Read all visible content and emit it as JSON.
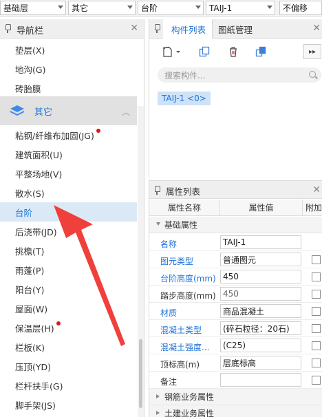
{
  "toolbar": {
    "combo1": "基础层",
    "combo2": "其它",
    "combo3": "台阶",
    "combo4": "TAIJ-1",
    "combo5": "不偏移"
  },
  "nav": {
    "title": "导航栏",
    "items_top": [
      "垫层(X)",
      "地沟(G)",
      "砖胎膜"
    ],
    "category": "其它",
    "items": [
      {
        "label": "粘钢/纤维布加固(JG)",
        "dot": true
      },
      {
        "label": "建筑面积(U)",
        "dot": false
      },
      {
        "label": "平整场地(V)",
        "dot": false
      },
      {
        "label": "散水(S)",
        "dot": false
      },
      {
        "label": "台阶",
        "dot": false,
        "active": true
      },
      {
        "label": "后浇带(JD)",
        "dot": false
      },
      {
        "label": "挑檐(T)",
        "dot": false
      },
      {
        "label": "雨蓬(P)",
        "dot": false
      },
      {
        "label": "阳台(Y)",
        "dot": false
      },
      {
        "label": "屋面(W)",
        "dot": false
      },
      {
        "label": "保温层(H)",
        "dot": true
      },
      {
        "label": "栏板(K)",
        "dot": false
      },
      {
        "label": "压顶(YD)",
        "dot": false
      },
      {
        "label": "栏杆扶手(G)",
        "dot": false
      },
      {
        "label": "脚手架(JS)",
        "dot": false
      }
    ]
  },
  "components": {
    "tab_active": "构件列表",
    "tab_other": "图纸管理",
    "search_placeholder": "搜索构件...",
    "selected": "TAIJ-1 <0>"
  },
  "properties": {
    "title": "属性列表",
    "col_name": "属性名称",
    "col_value": "属性值",
    "col_extra": "附加",
    "group_basic": "基础属性",
    "rows": [
      {
        "name": "名称",
        "value": "TAIJ-1",
        "link": true,
        "check": false
      },
      {
        "name": "图元类型",
        "value": "普通图元",
        "link": true,
        "check": true
      },
      {
        "name": "台阶高度(mm)",
        "value": "450",
        "link": true,
        "check": true
      },
      {
        "name": "踏步高度(mm)",
        "value": "450",
        "link": false,
        "check": true,
        "dim": true
      },
      {
        "name": "材质",
        "value": "商品混凝土",
        "link": true,
        "check": true
      },
      {
        "name": "混凝土类型",
        "value": "(碎石粒径：20石)",
        "link": true,
        "check": true
      },
      {
        "name": "混凝土强度...",
        "value": "(C25)",
        "link": true,
        "check": true
      },
      {
        "name": "顶标高(m)",
        "value": "层底标高",
        "link": false,
        "check": true
      },
      {
        "name": "备注",
        "value": "",
        "link": false,
        "check": true
      }
    ],
    "group_rebar": "钢筋业务属性",
    "group_civil": "土建业务属性"
  },
  "colors": {
    "accent": "#1e73d8",
    "arrow": "#f0403c",
    "dot": "#e0141c"
  }
}
